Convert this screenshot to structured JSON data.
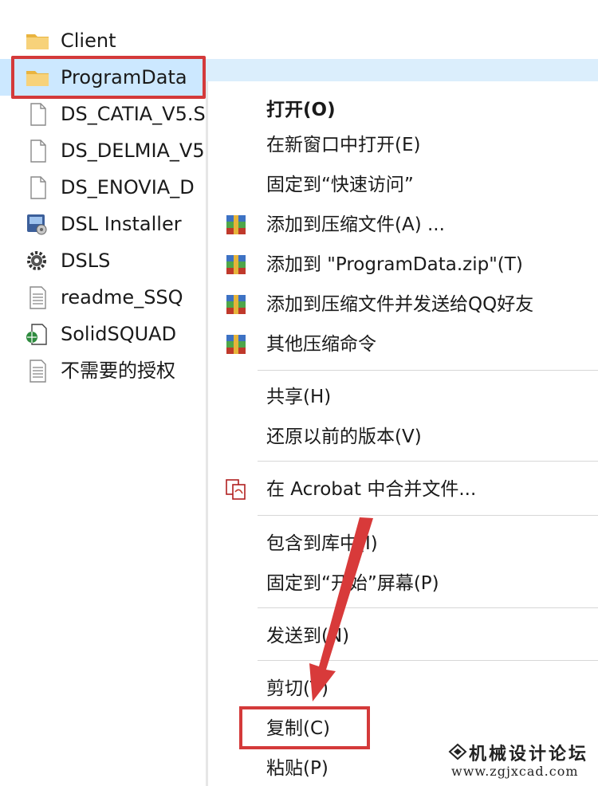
{
  "files": [
    {
      "name": "Client",
      "icon": "folder-icon"
    },
    {
      "name": "ProgramData",
      "icon": "folder-icon",
      "selected": true
    },
    {
      "name": "DS_CATIA_V5.S",
      "icon": "blank-file-icon"
    },
    {
      "name": "DS_DELMIA_V5",
      "icon": "blank-file-icon"
    },
    {
      "name": "DS_ENOVIA_D",
      "icon": "blank-file-icon"
    },
    {
      "name": "DSL Installer",
      "icon": "installer-icon"
    },
    {
      "name": "DSLS",
      "icon": "gear-icon"
    },
    {
      "name": "readme_SSQ",
      "icon": "text-file-icon"
    },
    {
      "name": "SolidSQUAD",
      "icon": "html-file-icon"
    },
    {
      "name": "不需要的授权",
      "icon": "text-file-icon"
    }
  ],
  "menu": {
    "items": [
      {
        "label": "打开(O)",
        "bold": true
      },
      {
        "label": "在新窗口中打开(E)"
      },
      {
        "label": "固定到“快速访问”"
      },
      {
        "label": "添加到压缩文件(A) ...",
        "icon": "winrar-archive-icon"
      },
      {
        "label": "添加到 \"ProgramData.zip\"(T)",
        "icon": "winrar-archive-icon"
      },
      {
        "label": "添加到压缩文件并发送给QQ好友",
        "icon": "winrar-archive-icon"
      },
      {
        "label": "其他压缩命令",
        "icon": "winrar-archive-icon"
      },
      {
        "label": "共享(H)"
      },
      {
        "label": "还原以前的版本(V)"
      },
      {
        "label": "在 Acrobat 中合并文件...",
        "icon": "acrobat-combine-icon"
      },
      {
        "label": "包含到库中(I)"
      },
      {
        "label": "固定到“开始”屏幕(P)"
      },
      {
        "label": "发送到(N)"
      },
      {
        "label": "剪切(T)"
      },
      {
        "label": "复制(C)",
        "highlighted": true
      },
      {
        "label": "粘贴(P)"
      }
    ]
  },
  "watermark": {
    "title": "机械设计论坛",
    "url": "www.zgjxcad.com"
  },
  "colors": {
    "highlight_outline": "#d43a3a",
    "selection": "#cce8ff",
    "folder": "#f4c55a"
  }
}
